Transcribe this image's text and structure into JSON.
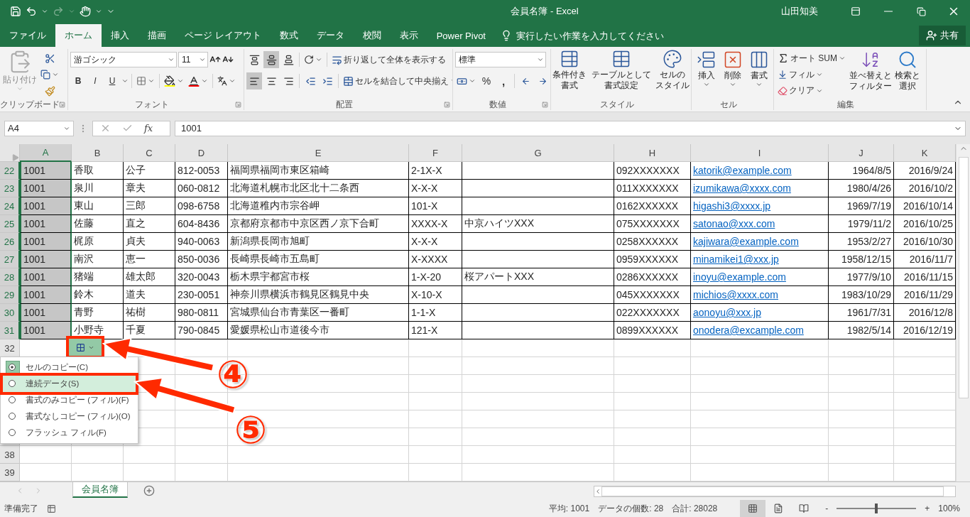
{
  "title_bar": {
    "title": "会員名簿 - Excel",
    "user": "山田知美"
  },
  "ribbon_tabs": [
    {
      "label": "ファイル",
      "selected": false
    },
    {
      "label": "ホーム",
      "selected": true
    },
    {
      "label": "挿入",
      "selected": false
    },
    {
      "label": "描画",
      "selected": false
    },
    {
      "label": "ページ レイアウト",
      "selected": false
    },
    {
      "label": "数式",
      "selected": false
    },
    {
      "label": "データ",
      "selected": false
    },
    {
      "label": "校閲",
      "selected": false
    },
    {
      "label": "表示",
      "selected": false
    },
    {
      "label": "Power Pivot",
      "selected": false
    }
  ],
  "tell_me": {
    "placeholder": "実行したい作業を入力してください"
  },
  "share_button": "共有",
  "ribbon": {
    "clipboard": {
      "paste": "貼り付け",
      "label": "クリップボード"
    },
    "font": {
      "font_name": "游ゴシック",
      "font_size": "11",
      "bold": "B",
      "italic": "I",
      "underline": "U",
      "label": "フォント"
    },
    "alignment": {
      "vertical": [
        {
          "selected": false
        },
        {
          "selected": true
        },
        {
          "selected": false
        }
      ],
      "horizontal": [
        {
          "selected": true
        },
        {
          "selected": false
        },
        {
          "selected": false
        }
      ],
      "wrap_text": "折り返して全体を表示する",
      "merge": "セルを結合して中央揃え",
      "label": "配置"
    },
    "number": {
      "format": "標準",
      "percent": "%",
      "comma": ",",
      "label": "数値"
    },
    "styles": {
      "buttons": [
        {
          "lines": [
            "条件付き",
            "書式"
          ]
        },
        {
          "lines": [
            "テーブルとして",
            "書式設定"
          ]
        },
        {
          "lines": [
            "セルの",
            "スタイル"
          ]
        }
      ],
      "label": "スタイル"
    },
    "cells": {
      "buttons": [
        "挿入",
        "削除",
        "書式"
      ],
      "label": "セル"
    },
    "editing": {
      "autosum": "オート SUM",
      "fill": "フィル",
      "clear": "クリア",
      "sort": [
        "並べ替えと",
        "フィルター"
      ],
      "find": [
        "検索と",
        "選択"
      ],
      "label": "編集"
    }
  },
  "formula_bar": {
    "name_box": "A4",
    "fx": "fx",
    "value": "1001"
  },
  "sheet": {
    "columns": [
      {
        "label": "A",
        "selected": true,
        "kind": "text"
      },
      {
        "label": "B",
        "selected": false,
        "kind": "text"
      },
      {
        "label": "C",
        "selected": false,
        "kind": "text"
      },
      {
        "label": "D",
        "selected": false,
        "kind": "text"
      },
      {
        "label": "E",
        "selected": false,
        "kind": "text"
      },
      {
        "label": "F",
        "selected": false,
        "kind": "text"
      },
      {
        "label": "G",
        "selected": false,
        "kind": "text"
      },
      {
        "label": "H",
        "selected": false,
        "kind": "text"
      },
      {
        "label": "I",
        "selected": false,
        "kind": "link"
      },
      {
        "label": "J",
        "selected": false,
        "kind": "date"
      },
      {
        "label": "K",
        "selected": false,
        "kind": "date"
      }
    ],
    "rows": [
      {
        "number": "22",
        "selected": true,
        "cells": [
          "1001",
          "香取",
          "公子",
          "812-0053",
          "福岡県福岡市東区箱崎",
          "2-1X-X",
          null,
          "092XXXXXXX",
          "katorik@example.com",
          "1964/8/5",
          "2016/9/24"
        ]
      },
      {
        "number": "23",
        "selected": true,
        "cells": [
          "1001",
          "泉川",
          "章夫",
          "060-0812",
          "北海道札幌市北区北十二条西",
          "X-X-X",
          null,
          "011XXXXXXX",
          "izumikawa@xxxx.com",
          "1980/4/26",
          "2016/10/2"
        ]
      },
      {
        "number": "24",
        "selected": true,
        "cells": [
          "1001",
          "東山",
          "三郎",
          "098-6758",
          "北海道稚内市宗谷岬",
          "101-X",
          null,
          "0162XXXXXX",
          "higashi3@xxxx.jp",
          "1969/7/19",
          "2016/10/14"
        ]
      },
      {
        "number": "25",
        "selected": true,
        "cells": [
          "1001",
          "佐藤",
          "直之",
          "604-8436",
          "京都府京都市中京区西ノ京下合町",
          "XXXX-X",
          "中京ハイツXXX",
          "075XXXXXXX",
          "satonao@xxx.com",
          "1979/11/2",
          "2016/10/25"
        ]
      },
      {
        "number": "26",
        "selected": true,
        "cells": [
          "1001",
          "梶原",
          "貞夫",
          "940-0063",
          "新潟県長岡市旭町",
          "X-X-X",
          null,
          "0258XXXXXX",
          "kajiwara@example.com",
          "1953/2/27",
          "2016/10/30"
        ]
      },
      {
        "number": "27",
        "selected": true,
        "cells": [
          "1001",
          "南沢",
          "恵一",
          "850-0036",
          "長崎県長崎市五島町",
          "X-XXXX",
          null,
          "0959XXXXXX",
          "minamikei1@xxx.jp",
          "1958/12/15",
          "2016/11/7"
        ]
      },
      {
        "number": "28",
        "selected": true,
        "cells": [
          "1001",
          "猪端",
          "雄太郎",
          "320-0043",
          "栃木県宇都宮市桜",
          "1-X-20",
          "桜アパートXXX",
          "0286XXXXXX",
          "inoyu@example.com",
          "1977/9/10",
          "2016/11/15"
        ]
      },
      {
        "number": "29",
        "selected": true,
        "cells": [
          "1001",
          "鈴木",
          "道夫",
          "230-0051",
          "神奈川県横浜市鶴見区鶴見中央",
          "X-10-X",
          null,
          "045XXXXXXX",
          "michios@xxxx.com",
          "1983/10/29",
          "2016/11/29"
        ]
      },
      {
        "number": "30",
        "selected": true,
        "cells": [
          "1001",
          "青野",
          "祐樹",
          "980-0811",
          "宮城県仙台市青葉区一番町",
          "1-1-X",
          null,
          "022XXXXXXX",
          "aonoyu@xxx.jp",
          "1961/7/31",
          "2016/12/8"
        ]
      },
      {
        "number": "31",
        "selected": true,
        "cells": [
          "1001",
          "小野寺",
          "千夏",
          "790-0845",
          "愛媛県松山市道後今市",
          "121-X",
          null,
          "0899XXXXXX",
          "onodera@excample.com",
          "1982/5/14",
          "2016/12/19"
        ]
      }
    ],
    "empty_rows": [
      {
        "number": "32"
      },
      {
        "number": "38"
      },
      {
        "number": "39"
      }
    ]
  },
  "autofill_button": {
    "framed": true
  },
  "autofill_menu": {
    "items": [
      {
        "label": "セルのコピー(C)",
        "selected": true,
        "highlighted": false,
        "framed": false
      },
      {
        "label": "連続データ(S)",
        "selected": false,
        "highlighted": true,
        "framed": true
      },
      {
        "label": "書式のみコピー (フィル)(F)",
        "selected": false,
        "highlighted": false,
        "framed": false
      },
      {
        "label": "書式なしコピー (フィル)(O)",
        "selected": false,
        "highlighted": false,
        "framed": false
      },
      {
        "label": "フラッシュ フィル(F)",
        "selected": false,
        "highlighted": false,
        "framed": false
      }
    ]
  },
  "annotations": [
    {
      "label": "④"
    },
    {
      "label": "⑤"
    }
  ],
  "sheet_tabs": [
    {
      "label": "会員名簿",
      "selected": true
    }
  ],
  "status_bar": {
    "ready": "準備完了",
    "average": "平均: 1001",
    "count": "データの個数: 28",
    "sum": "合計: 28028",
    "minus": "-",
    "zoom_slider": {
      "level": 0.5
    },
    "plus": "+",
    "zoom": "100%"
  }
}
